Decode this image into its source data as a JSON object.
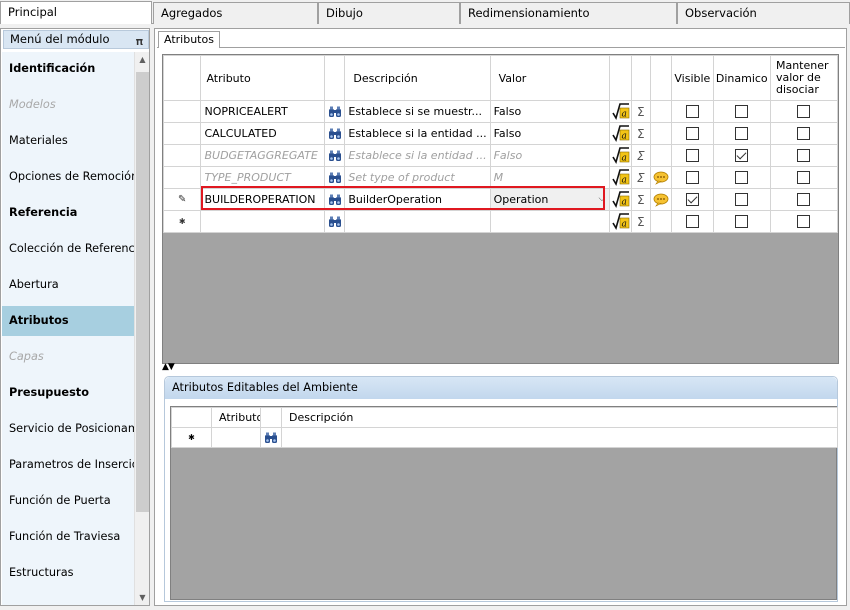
{
  "top_tabs": [
    "Principal",
    "Agregados",
    "Dibujo",
    "Redimensionamiento",
    "Observación"
  ],
  "left_panel": {
    "header": "Menú del módulo",
    "items": [
      {
        "label": "Identificación",
        "style": "bold"
      },
      {
        "label": "Modelos",
        "style": "disabled"
      },
      {
        "label": "Materiales",
        "style": "normal"
      },
      {
        "label": "Opciones de Remoción",
        "style": "normal"
      },
      {
        "label": "Referencia",
        "style": "bold"
      },
      {
        "label": "Colección de Referencias",
        "style": "normal"
      },
      {
        "label": "Abertura",
        "style": "normal"
      },
      {
        "label": "Atributos",
        "style": "selected"
      },
      {
        "label": "Capas",
        "style": "disabled"
      },
      {
        "label": "Presupuesto",
        "style": "bold"
      },
      {
        "label": "Servicio de Posicionamiento",
        "style": "normal"
      },
      {
        "label": "Parametros de Inserción",
        "style": "normal"
      },
      {
        "label": "Función de Puerta",
        "style": "normal"
      },
      {
        "label": "Función de Traviesa",
        "style": "normal"
      },
      {
        "label": "Estructuras",
        "style": "normal"
      }
    ]
  },
  "inner_tab": "Atributos",
  "grid": {
    "headers": {
      "attribute": "Atributo",
      "description": "Descripción",
      "value": "Valor",
      "visible": "Visible",
      "dynamic": "Dinamico",
      "keep": "Mantener valor de disociar"
    },
    "rows": [
      {
        "attribute": "NOPRICEALERT",
        "description": "Establece si se muestr...",
        "value": "Falso",
        "muted": false,
        "comment": false,
        "visible": false,
        "dynamic": false,
        "keep": false,
        "indicator": ""
      },
      {
        "attribute": "CALCULATED",
        "description": "Establece si la entidad ...",
        "value": "Falso",
        "muted": false,
        "comment": false,
        "visible": false,
        "dynamic": false,
        "keep": false,
        "indicator": ""
      },
      {
        "attribute": "BUDGETAGGREGATE",
        "description": "Establece si la entidad ...",
        "value": "Falso",
        "muted": true,
        "comment": false,
        "visible": false,
        "dynamic": true,
        "keep": false,
        "indicator": ""
      },
      {
        "attribute": "TYPE_PRODUCT",
        "description": "Set type of product",
        "value": "M",
        "muted": true,
        "comment": true,
        "visible": false,
        "dynamic": false,
        "keep": false,
        "indicator": ""
      },
      {
        "attribute": "BUILDEROPERATION",
        "description": "BuilderOperation",
        "value": "Operation",
        "muted": false,
        "comment": true,
        "visible": true,
        "dynamic": false,
        "keep": false,
        "indicator": "✎",
        "editing": true
      },
      {
        "attribute": "",
        "description": "",
        "value": "",
        "muted": false,
        "comment": false,
        "visible": false,
        "dynamic": false,
        "keep": false,
        "indicator": "✱",
        "new_row": true
      }
    ]
  },
  "env_section": {
    "title": "Atributos Editables del Ambiente",
    "headers": {
      "attribute": "Atributo",
      "description": "Descripción"
    },
    "new_row_indicator": "✱"
  }
}
